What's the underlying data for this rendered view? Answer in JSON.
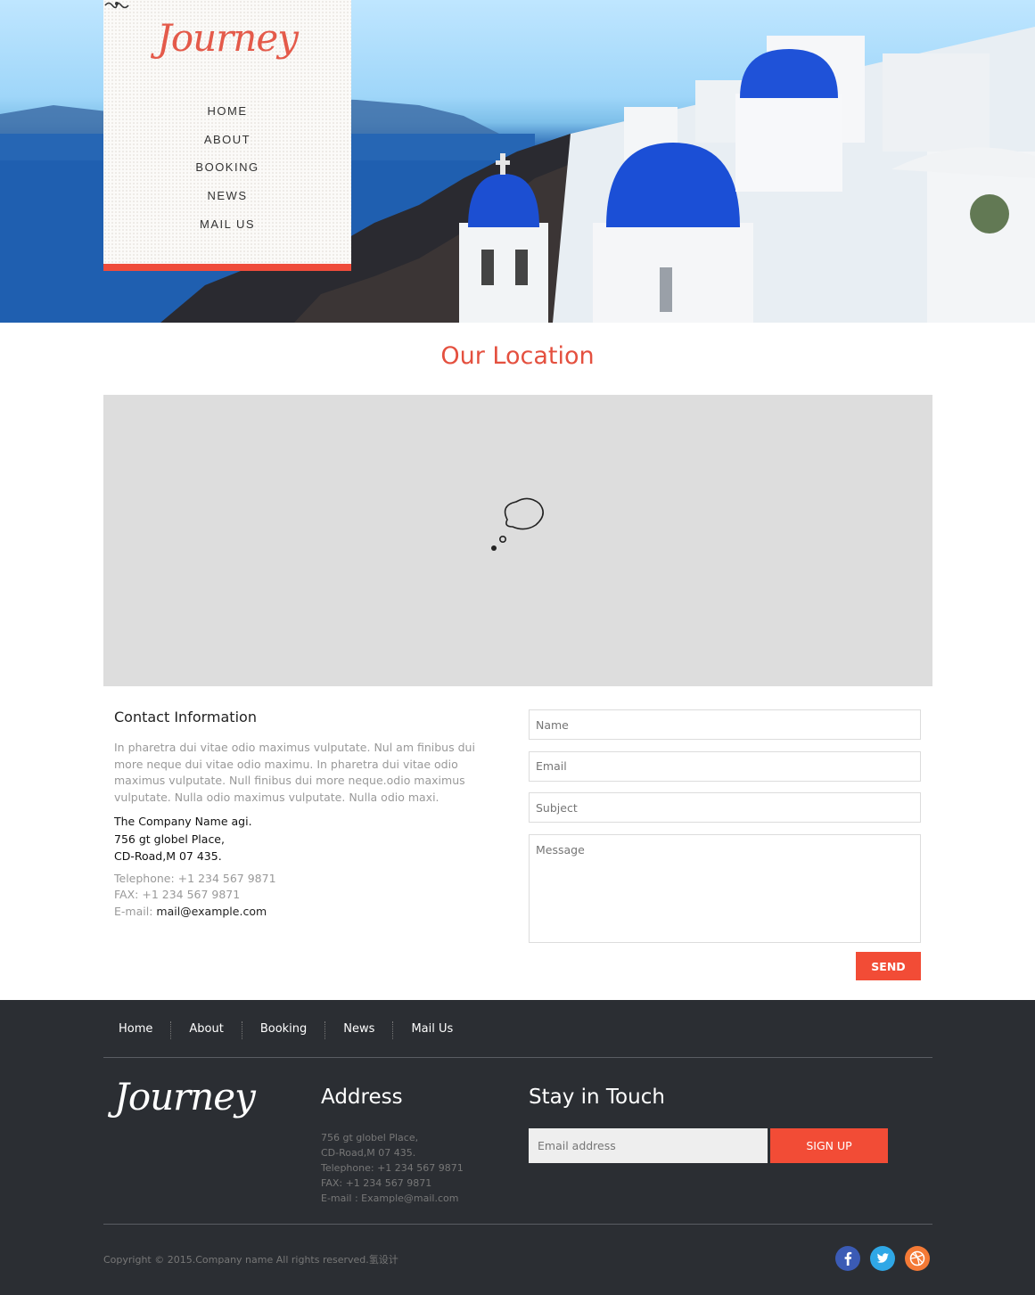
{
  "brand": {
    "logo_text": "Journey"
  },
  "nav": {
    "items": [
      "HOME",
      "ABOUT",
      "BOOKING",
      "NEWS",
      "MAIL US"
    ]
  },
  "location": {
    "title": "Our Location"
  },
  "contact": {
    "heading": "Contact Information",
    "description": "In pharetra dui vitae odio maximus vulputate. Nul am finibus dui more neque dui vitae odio maximu. In pharetra dui vitae odio maximus vulputate. Null finibus dui more neque.odio maximus vulputate. Nulla odio maximus vulputate. Nulla odio maxi.",
    "company_lines": [
      "The Company Name agi.",
      "756 gt globel Place,",
      "CD-Road,M 07 435."
    ],
    "telephone": "Telephone: +1 234 567 9871",
    "fax": "FAX: +1 234 567 9871",
    "email_label": "E-mail: ",
    "email_value": "mail@example.com"
  },
  "form": {
    "name_placeholder": "Name",
    "email_placeholder": "Email",
    "subject_placeholder": "Subject",
    "message_placeholder": "Message",
    "send_label": "SEND"
  },
  "footer": {
    "nav": [
      "Home",
      "About",
      "Booking",
      "News",
      "Mail Us"
    ],
    "logo_text": "Journey",
    "address_title": "Address",
    "address_lines": [
      "756 gt globel Place,",
      "CD-Road,M 07 435.",
      "Telephone: +1 234 567 9871",
      "FAX: +1 234 567 9871",
      "E-mail : Example@mail.com"
    ],
    "touch_title": "Stay in Touch",
    "email_placeholder": "Email address",
    "signup_label": "SIGN UP",
    "copyright": "Copyright © 2015.Company name All rights reserved.氢设计",
    "social": [
      "facebook-icon",
      "twitter-icon",
      "dribbble-icon"
    ]
  },
  "colors": {
    "accent": "#ef4c3b",
    "footer_bg": "#2b2e33",
    "map_bg": "#dddddd"
  }
}
